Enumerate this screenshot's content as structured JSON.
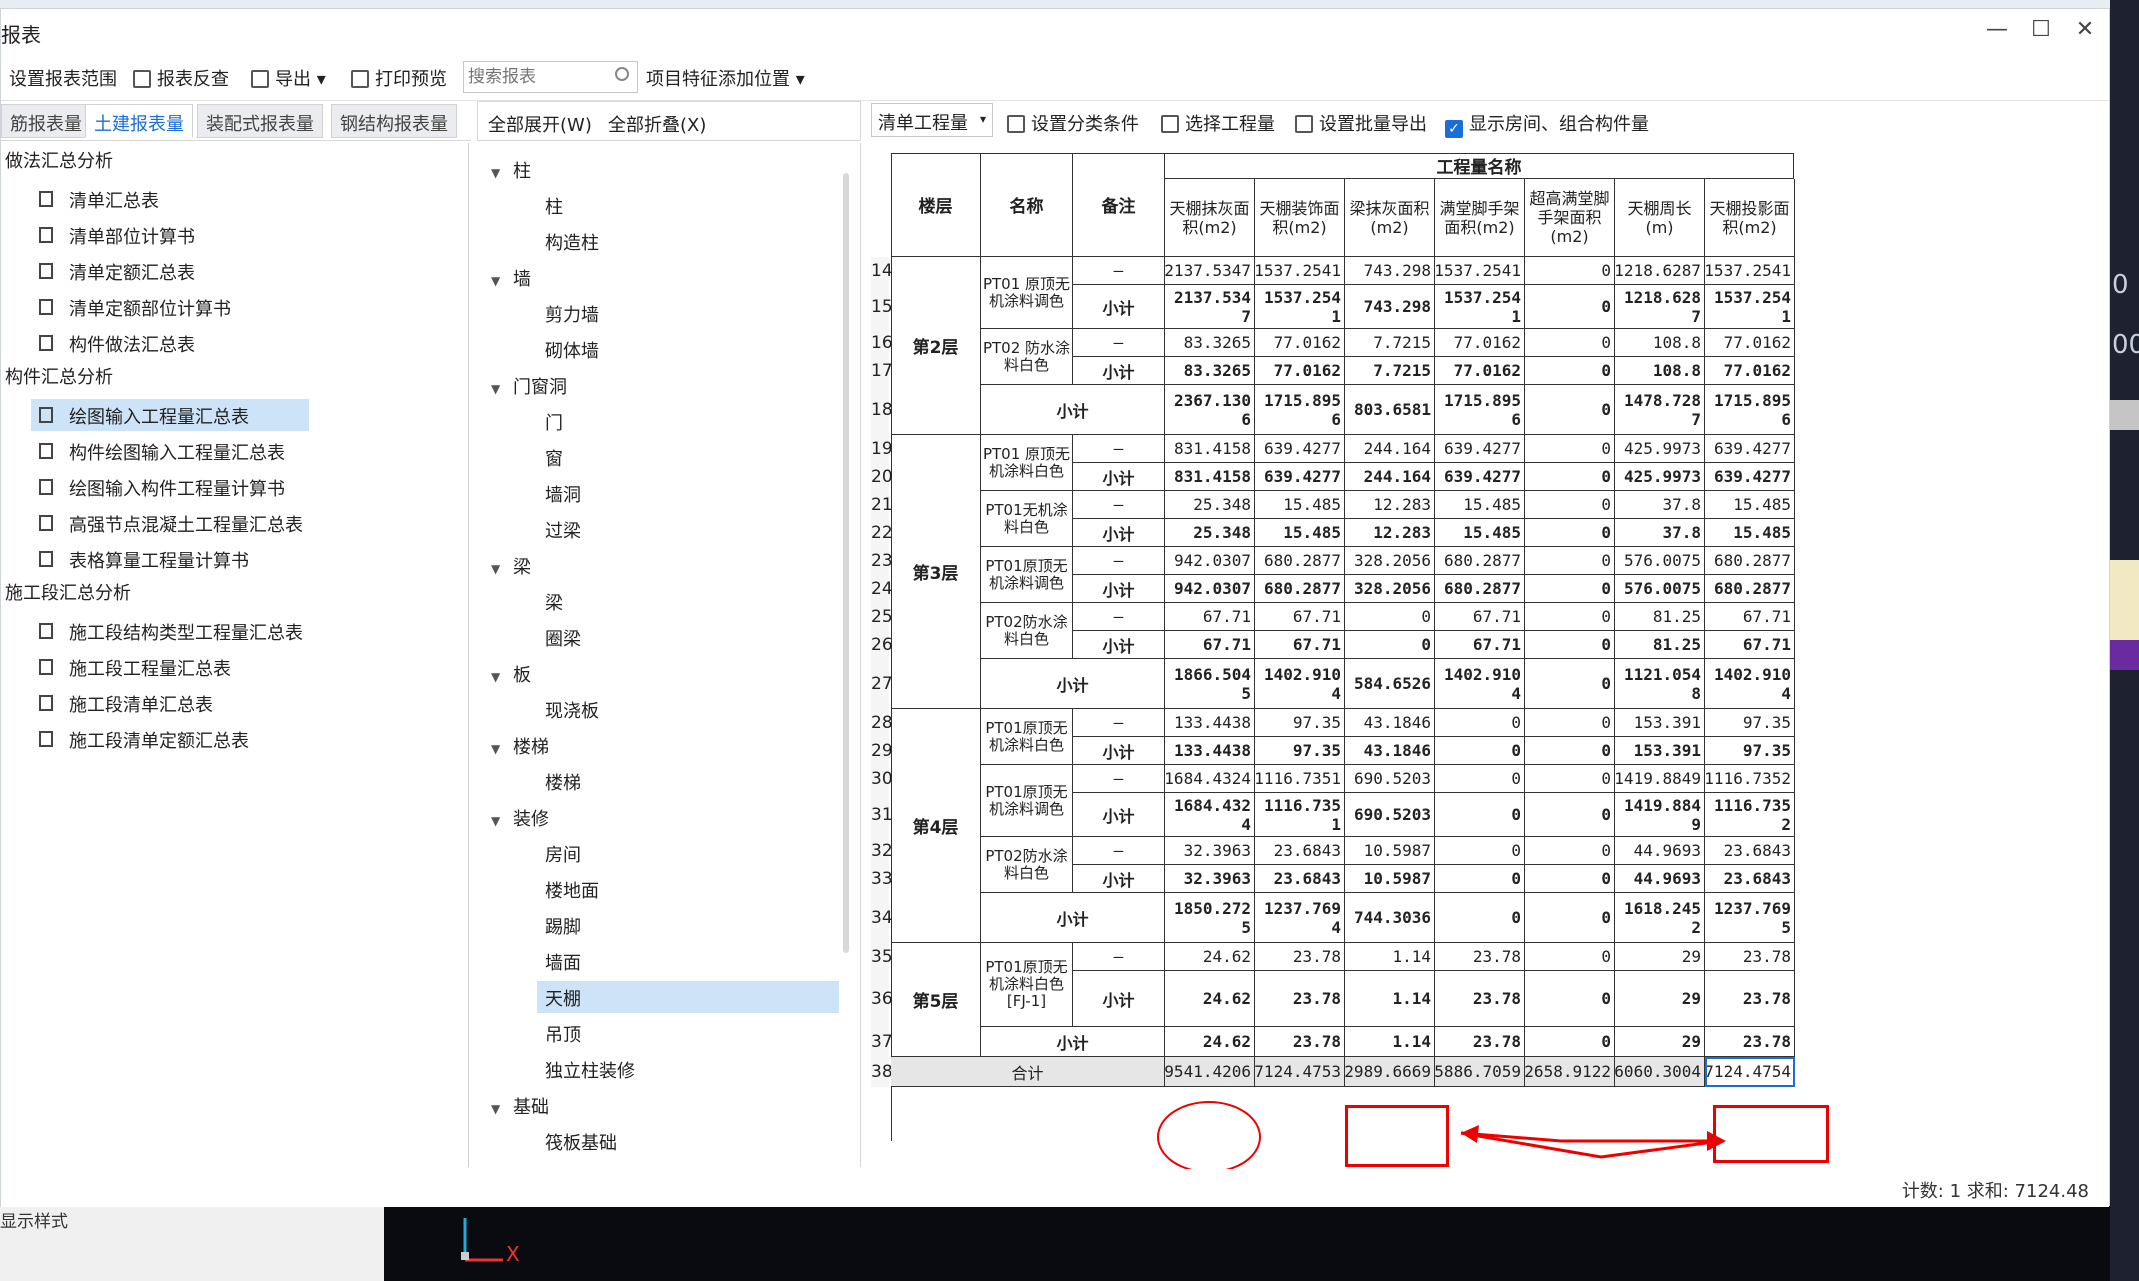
{
  "window": {
    "title": "报表"
  },
  "toolbar": [
    {
      "id": "range",
      "label": "设置报表范围"
    },
    {
      "id": "check",
      "label": "报表反查"
    },
    {
      "id": "export",
      "label": "导出"
    },
    {
      "id": "print",
      "label": "打印预览"
    }
  ],
  "search": {
    "placeholder": "搜索报表"
  },
  "feature_position": {
    "label": "项目特征添加位置"
  },
  "left_tabs": [
    "筋报表量",
    "土建报表量",
    "装配式报表量",
    "钢结构报表量"
  ],
  "left_tree": {
    "groups": [
      {
        "label": "做法汇总分析",
        "items": [
          "清单汇总表",
          "清单部位计算书",
          "清单定额汇总表",
          "清单定额部位计算书",
          "构件做法汇总表"
        ]
      },
      {
        "label": "构件汇总分析",
        "items": [
          "绘图输入工程量汇总表",
          "构件绘图输入工程量汇总表",
          "绘图输入构件工程量计算书",
          "高强节点混凝土工程量汇总表",
          "表格算量工程量计算书"
        ]
      },
      {
        "label": "施工段汇总分析",
        "items": [
          "施工段结构类型工程量汇总表",
          "施工段工程量汇总表",
          "施工段清单汇总表",
          "施工段清单定额汇总表"
        ]
      }
    ]
  },
  "middle": {
    "expand_all": "全部展开(W)",
    "collapse_all": "全部折叠(X)",
    "tree": [
      {
        "label": "柱",
        "children": [
          "柱",
          "构造柱"
        ]
      },
      {
        "label": "墙",
        "children": [
          "剪力墙",
          "砌体墙"
        ]
      },
      {
        "label": "门窗洞",
        "children": [
          "门",
          "窗",
          "墙洞",
          "过梁"
        ]
      },
      {
        "label": "梁",
        "children": [
          "梁",
          "圈梁"
        ]
      },
      {
        "label": "板",
        "children": [
          "现浇板"
        ]
      },
      {
        "label": "楼梯",
        "children": [
          "楼梯"
        ]
      },
      {
        "label": "装修",
        "children": [
          "房间",
          "楼地面",
          "踢脚",
          "墙面",
          "天棚",
          "吊顶",
          "独立柱装修"
        ]
      },
      {
        "label": "基础",
        "children": [
          "筏板基础"
        ]
      }
    ]
  },
  "right_toolbar": {
    "dropdown": "清单工程量",
    "set_category": "设置分类条件",
    "select_qty": "选择工程量",
    "batch_export": "设置批量导出",
    "show_rooms": "显示房间、组合构件量"
  },
  "table": {
    "group_header": "工程量名称",
    "headers": {
      "floor": "楼层",
      "name": "名称",
      "note": "备注",
      "c1": "天棚抹灰面积(m2)",
      "c2": "天棚装饰面积(m2)",
      "c3": "梁抹灰面积(m2)",
      "c4": "满堂脚手架面积(m2)",
      "c5": "超高满堂脚手架面积(m2)",
      "c6": "天棚周长(m)",
      "c7": "天棚投影面积(m2)"
    },
    "floors": [
      {
        "label": "第2层",
        "groups": [
          {
            "name": "PT01 原顶无机涂料调色",
            "rows": [
              {
                "n": "14",
                "note": "—",
                "v": [
                  "2137.5347",
                  "1537.2541",
                  "743.298",
                  "1537.2541",
                  "0",
                  "1218.6287",
                  "1537.2541"
                ]
              },
              {
                "n": "15",
                "note": "小计",
                "v": [
                  "2137.5347",
                  "1537.2541",
                  "743.298",
                  "1537.2541",
                  "0",
                  "1218.6287",
                  "1537.2541"
                ]
              }
            ]
          },
          {
            "name": "PT02 防水涂料白色",
            "rows": [
              {
                "n": "16",
                "note": "—",
                "v": [
                  "83.3265",
                  "77.0162",
                  "7.7215",
                  "77.0162",
                  "0",
                  "108.8",
                  "77.0162"
                ]
              },
              {
                "n": "17",
                "note": "小计",
                "v": [
                  "83.3265",
                  "77.0162",
                  "7.7215",
                  "77.0162",
                  "0",
                  "108.8",
                  "77.0162"
                ]
              }
            ]
          }
        ],
        "sub": {
          "n": "18",
          "label": "小计",
          "v": [
            "2367.1306",
            "1715.8956",
            "803.6581",
            "1715.8956",
            "0",
            "1478.7287",
            "1715.8956"
          ]
        }
      },
      {
        "label": "第3层",
        "groups": [
          {
            "name": "PT01 原顶无机涂料白色",
            "rows": [
              {
                "n": "19",
                "note": "—",
                "v": [
                  "831.4158",
                  "639.4277",
                  "244.164",
                  "639.4277",
                  "0",
                  "425.9973",
                  "639.4277"
                ]
              },
              {
                "n": "20",
                "note": "小计",
                "v": [
                  "831.4158",
                  "639.4277",
                  "244.164",
                  "639.4277",
                  "0",
                  "425.9973",
                  "639.4277"
                ]
              }
            ]
          },
          {
            "name": "PT01无机涂料白色",
            "rows": [
              {
                "n": "21",
                "note": "—",
                "v": [
                  "25.348",
                  "15.485",
                  "12.283",
                  "15.485",
                  "0",
                  "37.8",
                  "15.485"
                ]
              },
              {
                "n": "22",
                "note": "小计",
                "v": [
                  "25.348",
                  "15.485",
                  "12.283",
                  "15.485",
                  "0",
                  "37.8",
                  "15.485"
                ]
              }
            ]
          },
          {
            "name": "PT01原顶无机涂料调色",
            "rows": [
              {
                "n": "23",
                "note": "—",
                "v": [
                  "942.0307",
                  "680.2877",
                  "328.2056",
                  "680.2877",
                  "0",
                  "576.0075",
                  "680.2877"
                ]
              },
              {
                "n": "24",
                "note": "小计",
                "v": [
                  "942.0307",
                  "680.2877",
                  "328.2056",
                  "680.2877",
                  "0",
                  "576.0075",
                  "680.2877"
                ]
              }
            ]
          },
          {
            "name": "PT02防水涂料白色",
            "rows": [
              {
                "n": "25",
                "note": "—",
                "v": [
                  "67.71",
                  "67.71",
                  "0",
                  "67.71",
                  "0",
                  "81.25",
                  "67.71"
                ]
              },
              {
                "n": "26",
                "note": "小计",
                "v": [
                  "67.71",
                  "67.71",
                  "0",
                  "67.71",
                  "0",
                  "81.25",
                  "67.71"
                ]
              }
            ]
          }
        ],
        "sub": {
          "n": "27",
          "label": "小计",
          "v": [
            "1866.5045",
            "1402.9104",
            "584.6526",
            "1402.9104",
            "0",
            "1121.0548",
            "1402.9104"
          ]
        }
      },
      {
        "label": "第4层",
        "groups": [
          {
            "name": "PT01原顶无机涂料白色",
            "rows": [
              {
                "n": "28",
                "note": "—",
                "v": [
                  "133.4438",
                  "97.35",
                  "43.1846",
                  "0",
                  "0",
                  "153.391",
                  "97.35"
                ]
              },
              {
                "n": "29",
                "note": "小计",
                "v": [
                  "133.4438",
                  "97.35",
                  "43.1846",
                  "0",
                  "0",
                  "153.391",
                  "97.35"
                ]
              }
            ]
          },
          {
            "name": "PT01原顶无机涂料调色",
            "rows": [
              {
                "n": "30",
                "note": "—",
                "v": [
                  "1684.4324",
                  "1116.7351",
                  "690.5203",
                  "0",
                  "0",
                  "1419.8849",
                  "1116.7352"
                ]
              },
              {
                "n": "31",
                "note": "小计",
                "v": [
                  "1684.4324",
                  "1116.7351",
                  "690.5203",
                  "0",
                  "0",
                  "1419.8849",
                  "1116.7352"
                ]
              }
            ]
          },
          {
            "name": "PT02防水涂料白色",
            "rows": [
              {
                "n": "32",
                "note": "—",
                "v": [
                  "32.3963",
                  "23.6843",
                  "10.5987",
                  "0",
                  "0",
                  "44.9693",
                  "23.6843"
                ]
              },
              {
                "n": "33",
                "note": "小计",
                "v": [
                  "32.3963",
                  "23.6843",
                  "10.5987",
                  "0",
                  "0",
                  "44.9693",
                  "23.6843"
                ]
              }
            ]
          }
        ],
        "sub": {
          "n": "34",
          "label": "小计",
          "v": [
            "1850.2725",
            "1237.7694",
            "744.3036",
            "0",
            "0",
            "1618.2452",
            "1237.7695"
          ]
        }
      },
      {
        "label": "第5层",
        "groups": [
          {
            "name": "PT01原顶无机涂料白色[FJ-1]",
            "rows": [
              {
                "n": "35",
                "note": "—",
                "v": [
                  "24.62",
                  "23.78",
                  "1.14",
                  "23.78",
                  "0",
                  "29",
                  "23.78"
                ]
              },
              {
                "n": "36",
                "note": "小计",
                "v": [
                  "24.62",
                  "23.78",
                  "1.14",
                  "23.78",
                  "0",
                  "29",
                  "23.78"
                ]
              }
            ]
          }
        ],
        "sub": {
          "n": "37",
          "label": "小计",
          "v": [
            "24.62",
            "23.78",
            "1.14",
            "23.78",
            "0",
            "29",
            "23.78"
          ]
        }
      }
    ],
    "total": {
      "n": "38",
      "label": "合计",
      "v": [
        "9541.4206",
        "7124.4753",
        "2989.6669",
        "5886.7059",
        "2658.9122",
        "6060.3004",
        "7124.4754"
      ]
    }
  },
  "status": {
    "text": "计数: 1 求和: 7124.48"
  },
  "background": {
    "side_values": [
      "0",
      "00"
    ],
    "axis_label": "X",
    "display_style": "显示样式"
  },
  "colors": {
    "accent": "#1a6fd6",
    "annotation": "#e00000",
    "selection": "#cde3f7"
  }
}
